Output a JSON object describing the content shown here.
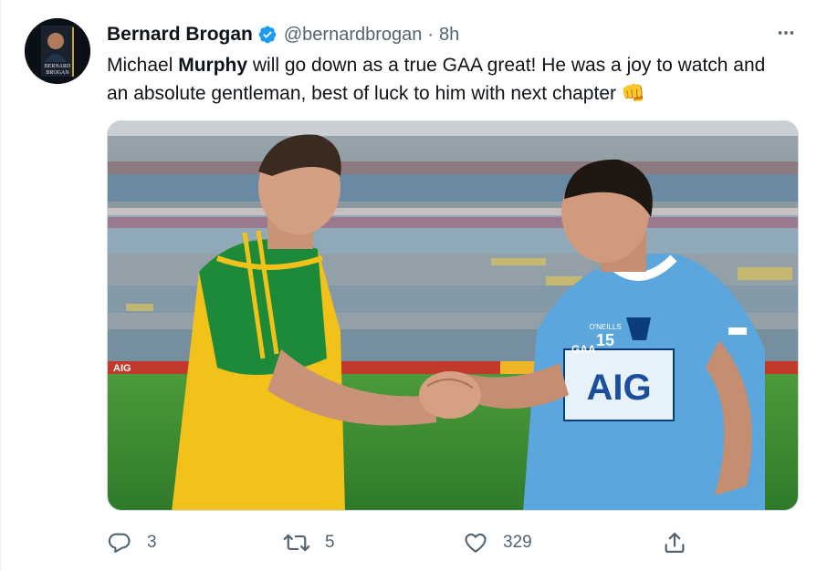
{
  "tweet": {
    "author_name": "Bernard Brogan",
    "handle": "@bernardbrogan",
    "separator": "·",
    "time": "8h",
    "text_part1": "Michael ",
    "text_bold": "Murphy",
    "text_part2": " will go down as a true GAA great! He was a joy to watch and an absolute gentleman, best of luck to him with next chapter ",
    "emoji": "👊",
    "avatar_text_line1": "BERNARD",
    "avatar_text_line2": "BROGAN",
    "media": {
      "sponsor_left": "AIG",
      "jersey_number": "15",
      "jersey_sponsor": "AIG",
      "jersey_brand": "O'NEILLS",
      "gaa_mark": "GAA"
    },
    "actions": {
      "reply_count": "3",
      "retweet_count": "5",
      "like_count": "329"
    }
  },
  "colors": {
    "verified": "#1d9bf0",
    "muted": "#536471",
    "dublin_blue": "#5aa6dd",
    "donegal_green": "#1d8a3a",
    "donegal_yellow": "#f2c21b",
    "pitch": "#3f8a32"
  },
  "icons": [
    "verified-badge-icon",
    "more-icon",
    "reply-icon",
    "retweet-icon",
    "like-icon",
    "share-icon"
  ]
}
